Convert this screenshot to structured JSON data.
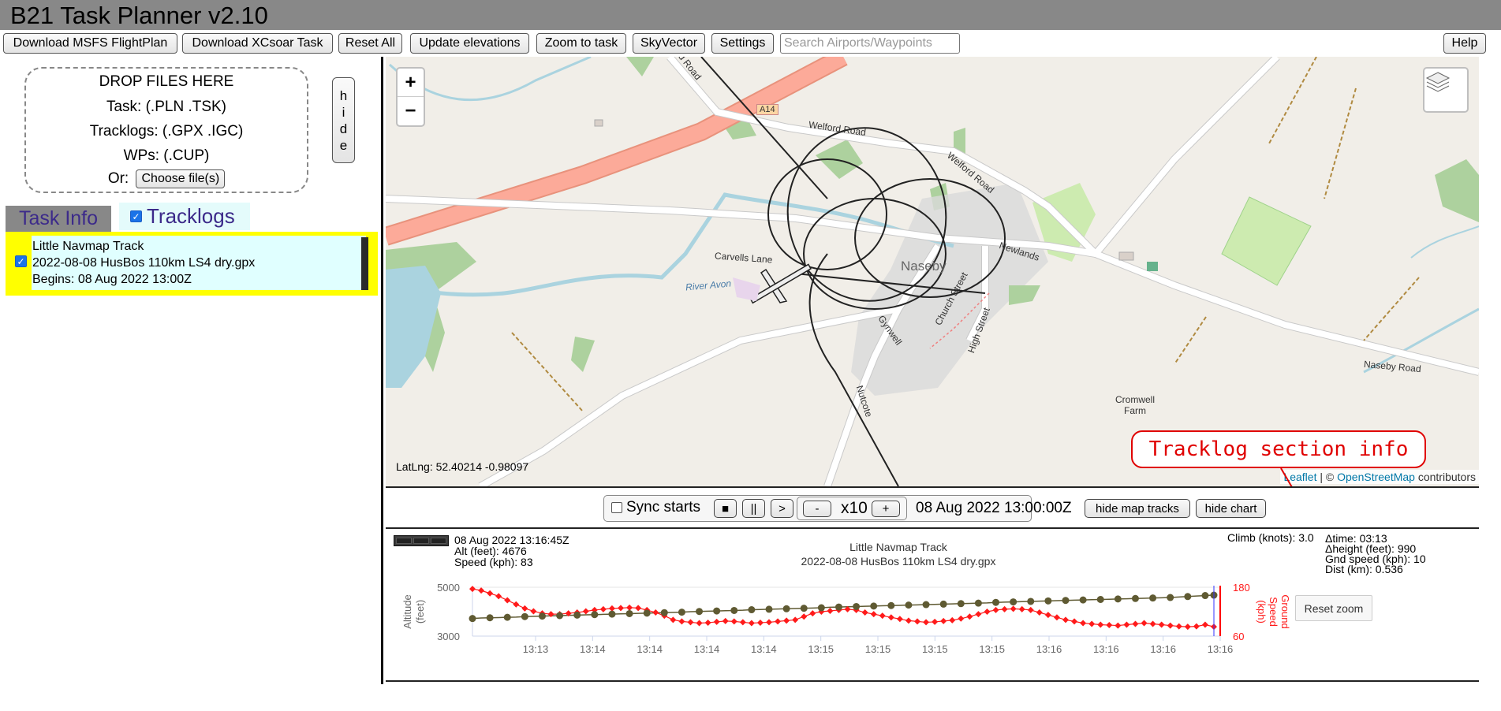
{
  "app": {
    "title": "B21 Task Planner v2.10"
  },
  "toolbar": {
    "buttons": [
      "Download MSFS FlightPlan",
      "Download XCsoar Task",
      "Reset All",
      "Update elevations",
      "Zoom to task",
      "SkyVector",
      "Settings"
    ],
    "search_placeholder": "Search Airports/Waypoints",
    "help": "Help"
  },
  "dropzone": {
    "line1": "DROP FILES HERE",
    "line2": "Task: (.PLN .TSK)",
    "line3": "Tracklogs: (.GPX .IGC)",
    "line4": "WPs: (.CUP)",
    "or": "Or:",
    "choose": "Choose file(s)"
  },
  "hide_button": [
    "h",
    "i",
    "d",
    "e"
  ],
  "tabs": {
    "task_info": "Task Info",
    "tracklogs": "Tracklogs",
    "tracklogs_checked": true
  },
  "tracklog": {
    "name": "Little Navmap Track",
    "file": "2022-08-08 HusBos 110km LS4 dry.gpx",
    "begins": "Begins: 08 Aug 2022 13:00Z",
    "checked": true
  },
  "map": {
    "zoom_in": "+",
    "zoom_out": "−",
    "latlng": "LatLng: 52.40214 -0.98097",
    "attribution_leaflet": "Leaflet",
    "attribution_sep": " | © ",
    "attribution_osm": "OpenStreetMap",
    "attribution_tail": " contributors",
    "labels": {
      "road1": "rd Road",
      "a14": "A14",
      "welford_road": "Welford Road",
      "welford_road2": "Welford Road",
      "carvells_lane": "Carvells Lane",
      "river_avon": "River Avon",
      "naseby": "Naseby",
      "newlands": "Newlands",
      "church_street": "Church Street",
      "gynwell": "Gynwell",
      "high_street": "High Street",
      "nutcote": "Nutcote",
      "naseby_road": "Naseby Road",
      "cromwell_farm": "Cromwell Farm"
    },
    "callout": "Tracklog section info"
  },
  "controls": {
    "sync_starts": "Sync starts",
    "stop": "■",
    "pause": "||",
    "play": ">",
    "minus": "-",
    "speed": "x10",
    "plus": "+",
    "time": "08 Aug 2022 13:00:00Z",
    "hide_map_tracks": "hide map tracks",
    "hide_chart": "hide chart"
  },
  "chart_panel": {
    "cursor_time": "08 Aug 2022 13:16:45Z",
    "cursor_alt": "Alt (feet): 4676",
    "cursor_speed": "Speed (kph): 83",
    "title": "Little Navmap Track",
    "subtitle": "2022-08-08 HusBos 110km LS4 dry.gpx",
    "climb": "Climb (knots): 3.0",
    "dtime": "Δtime: 03:13",
    "dheight": "Δheight (feet): 990",
    "gndspeed": "Gnd speed (kph): 10",
    "dist": "Dist (km): 0.536",
    "reset_zoom": "Reset zoom"
  },
  "colors": {
    "altitude": "#5f5a32",
    "speed": "#ff1a1a",
    "title_bar": "#888888",
    "track_panel": "#ffff00"
  },
  "chart_data": {
    "type": "line",
    "x_ticks": [
      "13:13",
      "13:14",
      "13:14",
      "13:14",
      "13:14",
      "13:15",
      "13:15",
      "13:15",
      "13:15",
      "13:16",
      "13:16",
      "13:16",
      "13:16"
    ],
    "ylabel_left": "Altitude\n(feet)",
    "ylabel_right": "Ground\nSpeed\n(kph)",
    "y_left": {
      "ticks": [
        "5000",
        "3000"
      ],
      "range": [
        3000,
        5000
      ]
    },
    "y_right": {
      "ticks": [
        "180",
        "60"
      ],
      "range": [
        60,
        180
      ]
    },
    "series": [
      {
        "name": "Alt (feet)",
        "axis": "left",
        "values": [
          3720,
          3740,
          3750,
          3760,
          3770,
          3780,
          3800,
          3810,
          3820,
          3830,
          3840,
          3850,
          3860,
          3870,
          3880,
          3890,
          3900,
          3910,
          3920,
          3930,
          3940,
          3950,
          3960,
          3970,
          3980,
          4000,
          4010,
          4020,
          4030,
          4040,
          4050,
          4060,
          4080,
          4090,
          4100,
          4110,
          4120,
          4130,
          4140,
          4150,
          4160,
          4180,
          4190,
          4200,
          4210,
          4220,
          4230,
          4240,
          4250,
          4260,
          4270,
          4280,
          4290,
          4300,
          4310,
          4320,
          4330,
          4340,
          4350,
          4360,
          4380,
          4390,
          4400,
          4410,
          4420,
          4430,
          4440,
          4450,
          4460,
          4470,
          4480,
          4490,
          4500,
          4510,
          4520,
          4530,
          4540,
          4550,
          4560,
          4570,
          4580,
          4600,
          4620,
          4640,
          4660,
          4676
        ]
      },
      {
        "name": "Speed (kph)",
        "axis": "right",
        "values": [
          176,
          172,
          165,
          158,
          148,
          138,
          128,
          121,
          116,
          114,
          114,
          116,
          118,
          121,
          124,
          126,
          128,
          129,
          130,
          129,
          124,
          118,
          110,
          100,
          96,
          94,
          92,
          93,
          95,
          97,
          96,
          94,
          92,
          93,
          94,
          96,
          98,
          100,
          108,
          116,
          120,
          122,
          124,
          126,
          124,
          118,
          114,
          110,
          106,
          102,
          98,
          96,
          94,
          95,
          97,
          99,
          103,
          108,
          114,
          120,
          124,
          126,
          127,
          126,
          124,
          118,
          112,
          106,
          100,
          96,
          92,
          90,
          88,
          87,
          86,
          88,
          90,
          92,
          90,
          88,
          86,
          84,
          83,
          84,
          88,
          83
        ]
      }
    ],
    "cursor_index": 85
  }
}
